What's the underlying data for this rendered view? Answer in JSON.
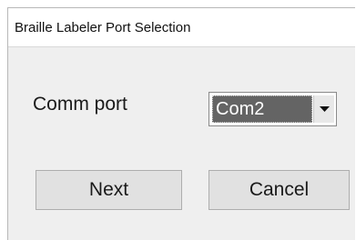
{
  "window": {
    "title": "Braille Labeler Port Selection"
  },
  "form": {
    "comm_port_label": "Comm port",
    "comm_port_value": "Com2"
  },
  "buttons": {
    "next_label": "Next",
    "cancel_label": "Cancel"
  },
  "icons": {
    "dropdown": "chevron-down-icon"
  }
}
